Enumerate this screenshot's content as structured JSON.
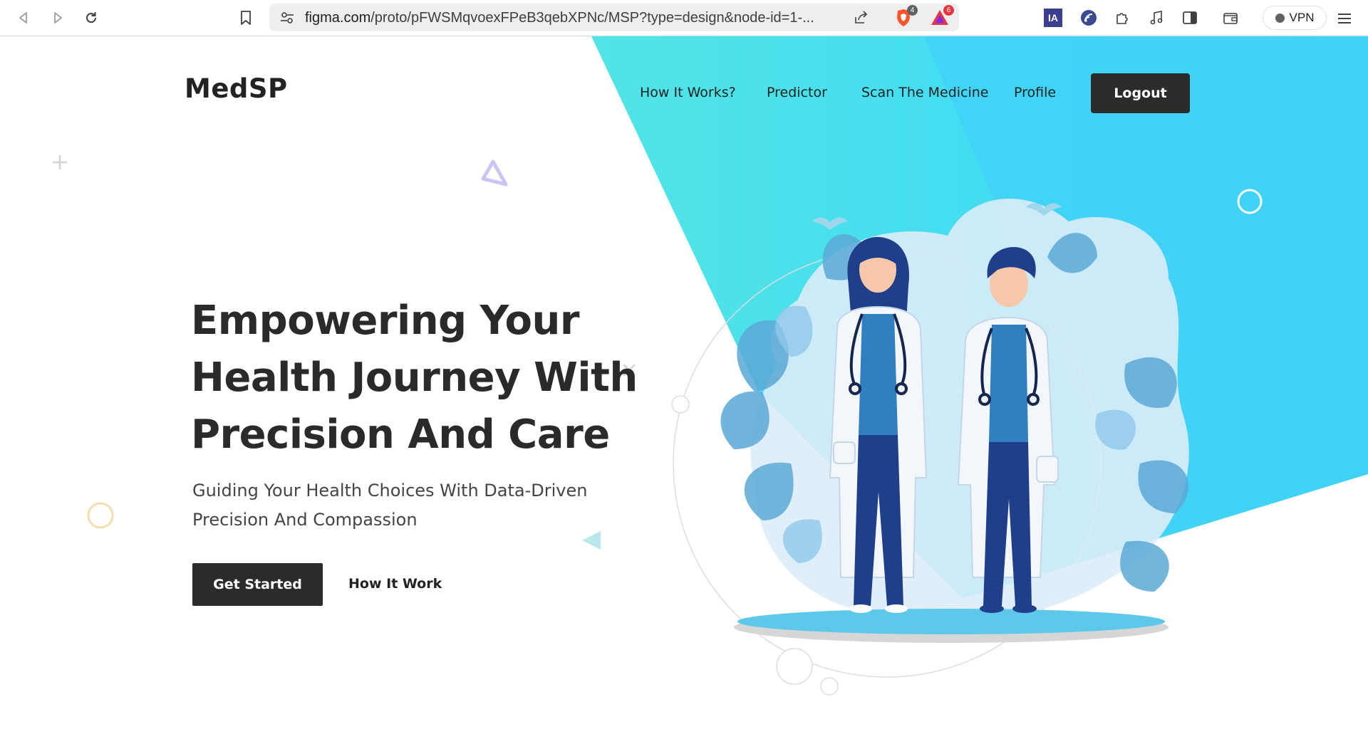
{
  "browser": {
    "url_domain": "figma.com",
    "url_path": "/proto/pFWSMqvoexFPeB3qebXPNc/MSP?type=design&node-id=1-...",
    "brave_shields_count": "4",
    "brave_rewards_count": "6",
    "ia_label": "IA",
    "vpn_label": "VPN"
  },
  "header": {
    "logo": "MedSP",
    "nav": [
      {
        "label": "How It Works?"
      },
      {
        "label": "Predictor"
      },
      {
        "label": "Scan The Medicine"
      },
      {
        "label": "Profile"
      }
    ],
    "logout_label": "Logout"
  },
  "hero": {
    "title_lines": [
      "Empowering Your",
      "Health Journey With",
      "Precision And Care"
    ],
    "subtitle_lines": [
      "Guiding Your Health Choices With Data-Driven",
      "Precision And Compassion"
    ],
    "primary_cta": "Get Started",
    "secondary_cta": "How It Work"
  },
  "colors": {
    "cyan_light": "#4fe3e6",
    "cyan_blue": "#3ecff5",
    "dark_button": "#2b2b2b",
    "scrub_blue": "#2f7fc1",
    "navy_pants": "#1f3f8a"
  }
}
